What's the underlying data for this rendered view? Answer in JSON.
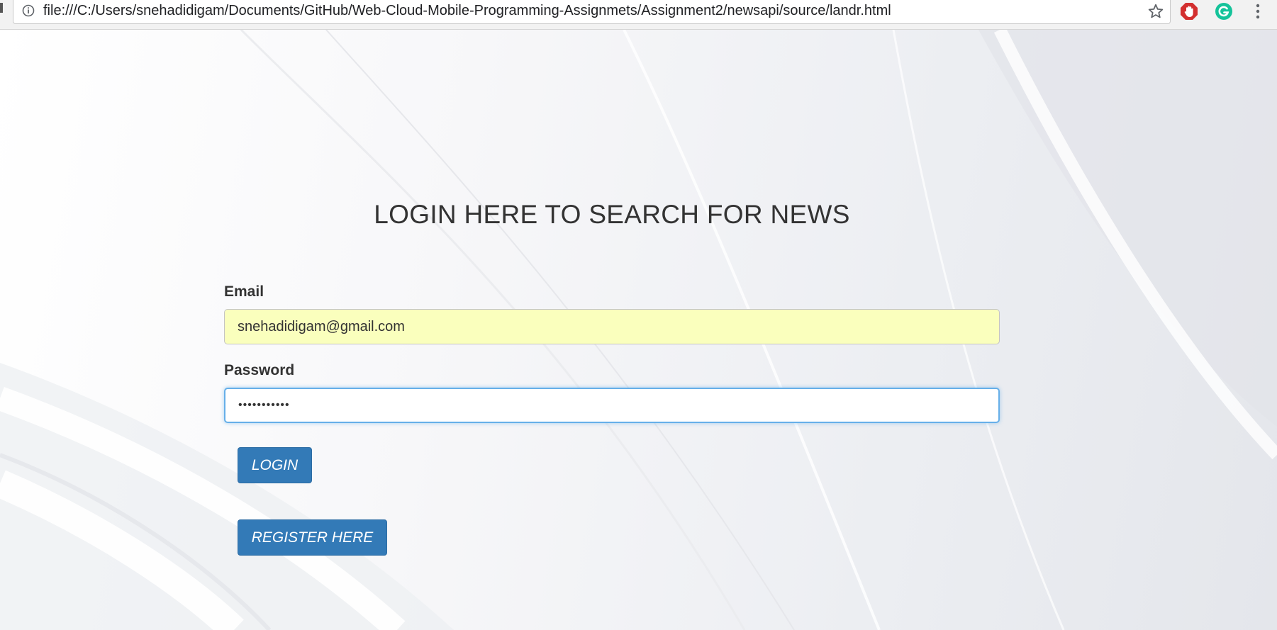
{
  "browser": {
    "url": "file:///C:/Users/snehadidigam/Documents/GitHub/Web-Cloud-Mobile-Programming-Assignmets/Assignment2/newsapi/source/landr.html"
  },
  "page": {
    "title": "LOGIN HERE TO SEARCH FOR NEWS"
  },
  "form": {
    "email_label": "Email",
    "email_value": "snehadidigam@gmail.com",
    "password_label": "Password",
    "password_value": "sneha123456"
  },
  "buttons": {
    "login_label": "LOGIN",
    "register_label": "REGISTER HERE"
  },
  "colors": {
    "primary_button": "#337ab7",
    "autofill_bg": "#faffbd",
    "focus_border": "#66afe9"
  }
}
